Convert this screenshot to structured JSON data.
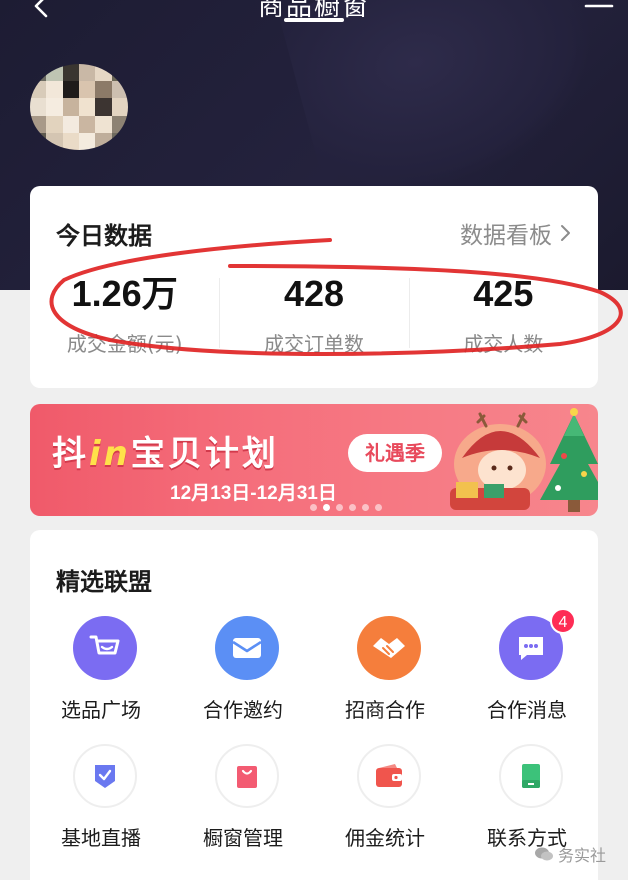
{
  "header": {
    "title": "商品橱窗",
    "back_icon": "chevron-left-icon",
    "menu_icon": "menu-icon",
    "profile_name": "",
    "profile_subtitle": ""
  },
  "data_card": {
    "title": "今日数据",
    "link_label": "数据看板",
    "link_icon": "chevron-right-icon",
    "stats": [
      {
        "value": "1.26万",
        "label": "成交金额(元)"
      },
      {
        "value": "428",
        "label": "成交订单数"
      },
      {
        "value": "425",
        "label": "成交人数"
      }
    ]
  },
  "banner": {
    "title_prefix": "抖",
    "title_in": "in",
    "title_suffix": "宝贝计划",
    "tag": "礼遇季",
    "date": "12月13日-12月31日",
    "dot_count": 6,
    "active_dot": 1
  },
  "union": {
    "title": "精选联盟",
    "items": [
      {
        "label": "选品广场",
        "icon": "shopping-cart-icon",
        "color": "#7b6cf2"
      },
      {
        "label": "合作邀约",
        "icon": "envelope-icon",
        "color": "#5b8ff5"
      },
      {
        "label": "招商合作",
        "icon": "handshake-icon",
        "color": "#f57e3c"
      },
      {
        "label": "合作消息",
        "icon": "chat-bubble-icon",
        "color": "#7b6cf2",
        "badge": "4"
      },
      {
        "label": "基地直播",
        "icon": "shield-badge-icon",
        "color": "#6a78f0"
      },
      {
        "label": "橱窗管理",
        "icon": "shopping-bag-icon",
        "color": "#f35b72"
      },
      {
        "label": "佣金统计",
        "icon": "wallet-icon",
        "color": "#f0554d"
      },
      {
        "label": "联系方式",
        "icon": "phone-card-icon",
        "color": "#3cc27a"
      }
    ]
  },
  "watermark": {
    "text": "务实社",
    "icon": "wechat-icon"
  },
  "colors": {
    "header_bg": "#1d1c33",
    "accent_red": "#fe2c55",
    "annotation_red": "#e02424",
    "banner_pink": "#f05a6a"
  }
}
